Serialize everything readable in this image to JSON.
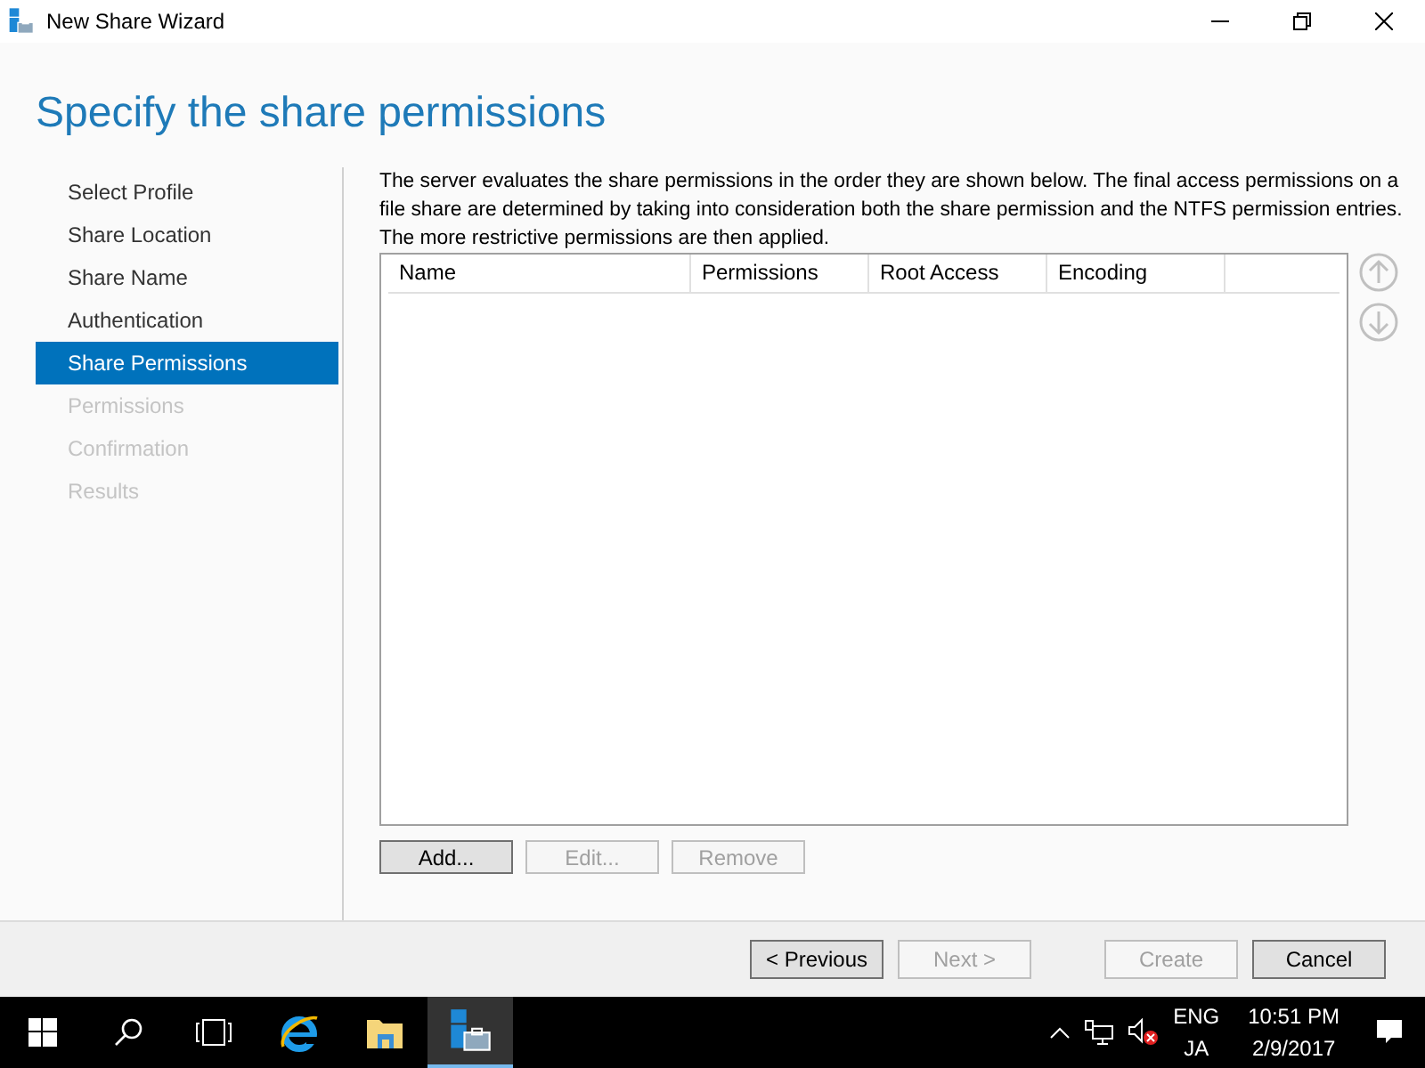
{
  "window": {
    "title": "New Share Wizard"
  },
  "heading": "Specify the share permissions",
  "steps": [
    {
      "label": "Select Profile",
      "selected": false,
      "disabled": false
    },
    {
      "label": "Share Location",
      "selected": false,
      "disabled": false
    },
    {
      "label": "Share Name",
      "selected": false,
      "disabled": false
    },
    {
      "label": "Authentication",
      "selected": false,
      "disabled": false
    },
    {
      "label": "Share Permissions",
      "selected": true,
      "disabled": false
    },
    {
      "label": "Permissions",
      "selected": false,
      "disabled": true
    },
    {
      "label": "Confirmation",
      "selected": false,
      "disabled": true
    },
    {
      "label": "Results",
      "selected": false,
      "disabled": true
    }
  ],
  "description": "The server evaluates the share permissions in the order they are shown below. The final access permissions on a file share are determined by taking into consideration both the share permission and the NTFS permission entries. The more restrictive permissions are then applied.",
  "table": {
    "columns": [
      "Name",
      "Permissions",
      "Root Access",
      "Encoding"
    ]
  },
  "list_buttons": [
    {
      "label": "Add...",
      "disabled": false
    },
    {
      "label": "Edit...",
      "disabled": true
    },
    {
      "label": "Remove",
      "disabled": true
    }
  ],
  "footer_buttons": [
    {
      "label": "< Previous",
      "disabled": false
    },
    {
      "label": "Next >",
      "disabled": true
    },
    {
      "label": "Create",
      "disabled": true
    },
    {
      "label": "Cancel",
      "disabled": false
    }
  ],
  "taskbar": {
    "language": "ENG",
    "layout": "JA",
    "time": "10:51 PM",
    "date": "2/9/2017"
  }
}
